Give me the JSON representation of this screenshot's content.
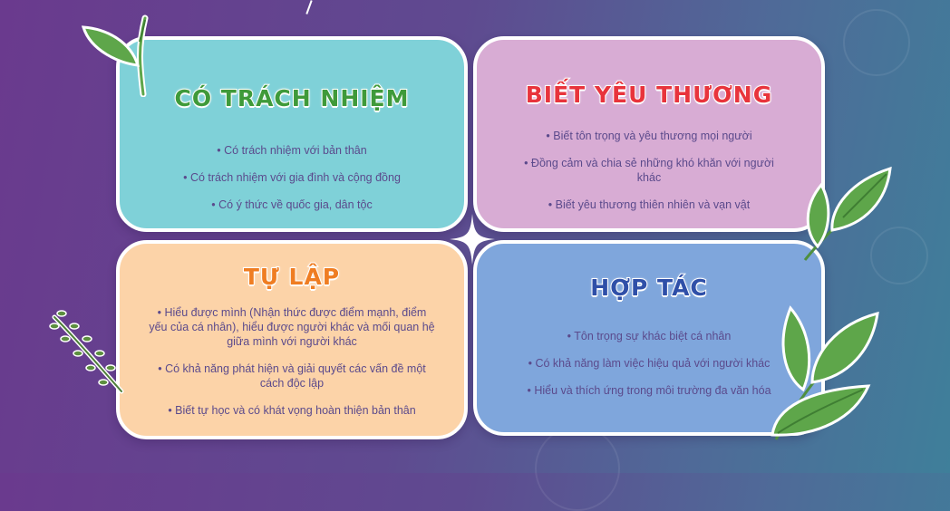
{
  "cards": [
    {
      "title": "CÓ TRÁCH NHIỆM",
      "items": [
        "Có trách nhiệm với bản thân",
        "Có trách nhiệm với gia đình và cộng đồng",
        "Có ý thức về quốc gia, dân tộc"
      ]
    },
    {
      "title": "BIẾT YÊU THƯƠNG",
      "items": [
        "Biết tôn trọng và yêu thương mọi người",
        "Đồng cảm và chia sẻ những khó khăn với người khác",
        "Biết yêu thương thiên nhiên và vạn vật"
      ]
    },
    {
      "title": "TỰ LẬP",
      "items": [
        "Hiểu được mình (Nhận thức được điểm mạnh, điểm yếu của cá nhân), hiểu được người khác và mối quan hệ giữa mình với người khác",
        "Có khả năng phát hiện và giải quyết các vấn đề một cách độc lập",
        "Biết tự học và có khát vọng hoàn thiện bản thân"
      ]
    },
    {
      "title": "HỢP TÁC",
      "items": [
        "Tôn trọng sự khác biệt cá nhân",
        "Có khả năng làm việc hiệu quả với người khác",
        "Hiểu và thích ứng trong môi trường đa văn hóa"
      ]
    }
  ],
  "colors": {
    "card1_bg": "#7fd1d8",
    "card1_title": "#3f9a3a",
    "card2_bg": "#d8acd4",
    "card2_title": "#e8343c",
    "card3_bg": "#fcd3a8",
    "card3_title": "#ef7d22",
    "card4_bg": "#7fa6dc",
    "card4_title": "#2f4fa8",
    "text": "#5b4a8c",
    "leaf": "#5ea64a"
  },
  "icons": [
    "leaf-icon",
    "sparkle-icon",
    "fern-icon"
  ]
}
